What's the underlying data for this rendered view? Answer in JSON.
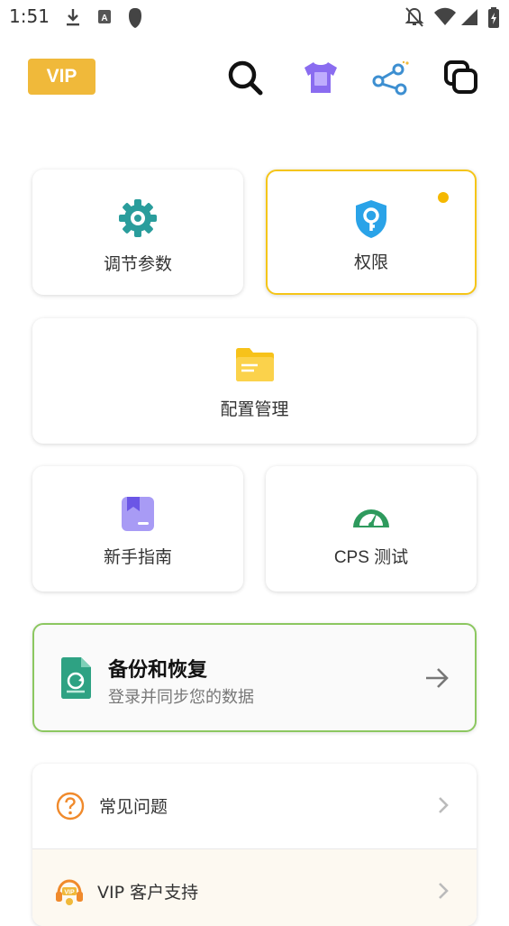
{
  "status_bar": {
    "time": "1:51",
    "icons": [
      "download-icon",
      "text-a-icon",
      "shield-icon",
      "bell-off-icon",
      "wifi-icon",
      "signal-icon",
      "battery-charging-icon"
    ]
  },
  "topbar": {
    "vip_label": "VIP",
    "icons": [
      "search-icon",
      "theme-shirt-icon",
      "share-icon",
      "copy-windows-icon"
    ]
  },
  "tiles": {
    "adjust": {
      "label": "调节参数",
      "icon": "gear-icon"
    },
    "permission": {
      "label": "权限",
      "icon": "key-shield-icon",
      "has_dot": true
    },
    "config": {
      "label": "配置管理",
      "icon": "folder-icon"
    },
    "guide": {
      "label": "新手指南",
      "icon": "bookmark-book-icon"
    },
    "cps": {
      "label": "CPS 测试",
      "icon": "speedometer-icon"
    }
  },
  "backup": {
    "title": "备份和恢复",
    "subtitle": "登录并同步您的数据",
    "icon": "sync-document-icon",
    "action_icon": "arrow-right-icon"
  },
  "list": [
    {
      "label": "常见问题",
      "icon": "question-circle-icon"
    },
    {
      "label": "VIP 客户支持",
      "icon": "vip-headset-icon"
    }
  ],
  "colors": {
    "vip": "#f0b93a",
    "gear": "#2a9d9c",
    "shield": "#2aa3e8",
    "folder": "#f7c21a",
    "bookmark": "#8b7cf0",
    "speedometer": "#2e9a5d",
    "backup_border": "#8cc760",
    "active_border": "#f5c518",
    "question": "#f08a2c"
  }
}
